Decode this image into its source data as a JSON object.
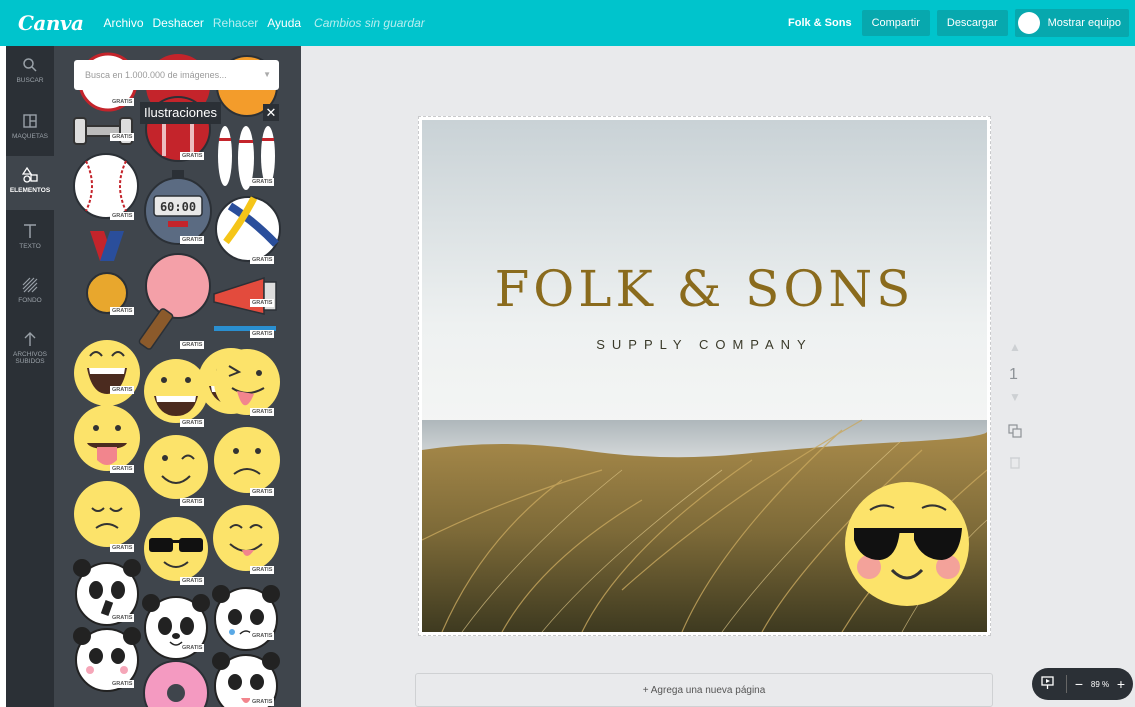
{
  "topbar": {
    "logo": "Canva",
    "menu": [
      "Archivo",
      "Deshacer",
      "Rehacer",
      "Ayuda"
    ],
    "unsaved": "Cambios sin guardar",
    "doc_name": "Folk & Sons",
    "share": "Compartir",
    "download": "Descargar",
    "team": "Mostrar equipo"
  },
  "rail": [
    {
      "label": "BUSCAR",
      "icon": "search-icon"
    },
    {
      "label": "MAQUETAS",
      "icon": "layout-icon"
    },
    {
      "label": "ELEMENTOS",
      "icon": "shapes-icon"
    },
    {
      "label": "TEXTO",
      "icon": "text-icon"
    },
    {
      "label": "FONDO",
      "icon": "background-icon"
    },
    {
      "label": "ARCHIVOS SUBIDOS",
      "icon": "upload-icon"
    }
  ],
  "panel": {
    "search_placeholder": "Busca en 1.000.000 de imágenes...",
    "tooltip": "Ilustraciones",
    "badge": "GRATIS"
  },
  "design": {
    "title": "FOLK & SONS",
    "subtitle": "SUPPLY COMPANY"
  },
  "page_number": "1",
  "add_page": "+ Agrega una nueva página",
  "zoom": {
    "value": "89 %"
  },
  "colors": {
    "accent": "#00c4cc",
    "rail": "#2b3036",
    "panel": "#3f454c",
    "title": "#8a6b1d"
  }
}
